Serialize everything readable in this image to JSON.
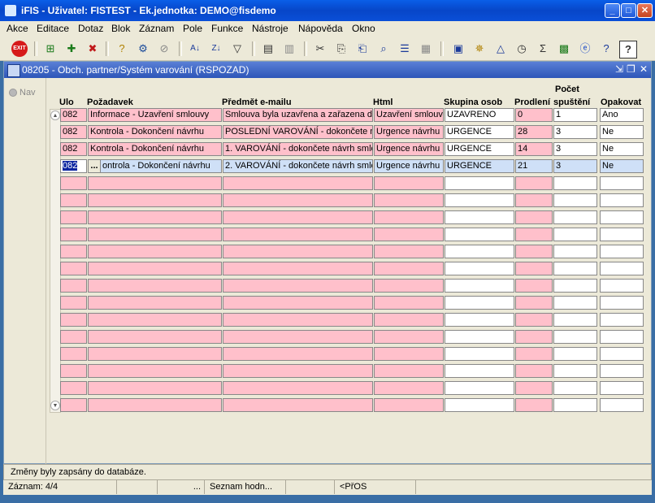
{
  "window": {
    "title": "iFIS - Uživatel: FISTEST - Ek.jednotka: DEMO@fisdemo",
    "controls": [
      "_",
      "□",
      "✕"
    ]
  },
  "menu": [
    "Akce",
    "Editace",
    "Dotaz",
    "Blok",
    "Záznam",
    "Pole",
    "Funkce",
    "Nástroje",
    "Nápověda",
    "Okno"
  ],
  "toolbar": {
    "exit_label": "EXIT"
  },
  "form": {
    "title": "08205 - Obch. partner/Systém varování (RSPOZAD)",
    "nav_label": "Nav",
    "columns": {
      "ulo": "Ulo",
      "pozadavek": "Požadavek",
      "predmet": "Předmět e-mailu",
      "html": "Html",
      "skupina": "Skupina osob",
      "prodleni": "Prodlení",
      "pocet_top": "Počet",
      "pocet_bottom": "spuštění",
      "opakovat": "Opakovat"
    },
    "rows": [
      {
        "ulo": "082",
        "pozadavek": "Informace - Uzavření smlouvy",
        "predmet": "Smlouva byla uzavřena a zařazena d",
        "html": "Uzavření smlouvy",
        "skupina": "UZAVRENO",
        "prodleni": "0",
        "pocet": "1",
        "opakovat": "Ano"
      },
      {
        "ulo": "082",
        "pozadavek": "Kontrola - Dokončení návrhu",
        "predmet": "POSLEDNÍ VAROVÁNÍ - dokončete ná",
        "html": "Urgence návrhu",
        "skupina": "URGENCE",
        "prodleni": "28",
        "pocet": "3",
        "opakovat": "Ne"
      },
      {
        "ulo": "082",
        "pozadavek": "Kontrola - Dokončení návrhu",
        "predmet": "1. VAROVÁNÍ - dokončete návrh smlo",
        "html": "Urgence návrhu",
        "skupina": "URGENCE",
        "prodleni": "14",
        "pocet": "3",
        "opakovat": "Ne"
      },
      {
        "ulo": "082",
        "pozadavek": "ontrola - Dokončení návrhu",
        "pozadavek_button": "...",
        "predmet": "2. VAROVÁNÍ - dokončete návrh smlo",
        "html": "Urgence návrhu",
        "skupina": "URGENCE",
        "prodleni": "21",
        "pocet": "3",
        "opakovat": "Ne"
      }
    ],
    "empty_rows": 14,
    "current_row": 4
  },
  "status": {
    "message": "Změny byly zapsány do databáze.",
    "record": "Záznam: 4/4",
    "ellipsis": "...",
    "list": "Seznam hodn...",
    "mode": "<PřOS"
  }
}
